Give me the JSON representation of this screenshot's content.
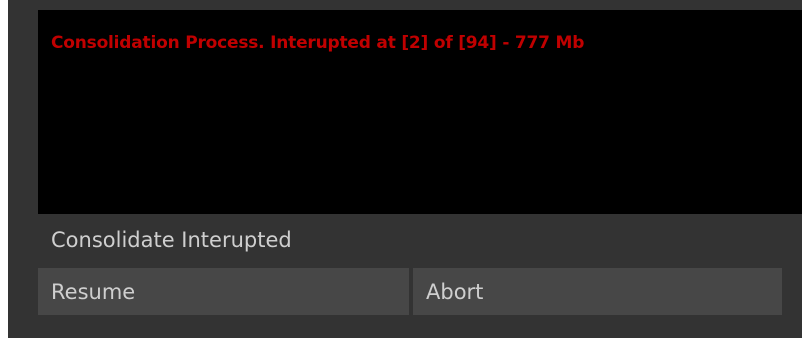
{
  "log": {
    "message": "Consolidation Process. Interupted at [2] of [94] - 777 Mb",
    "message_color": "#c00000",
    "background_color": "#000000"
  },
  "status": {
    "text": "Consolidate Interupted"
  },
  "buttons": {
    "resume_label": "Resume",
    "abort_label": "Abort"
  }
}
